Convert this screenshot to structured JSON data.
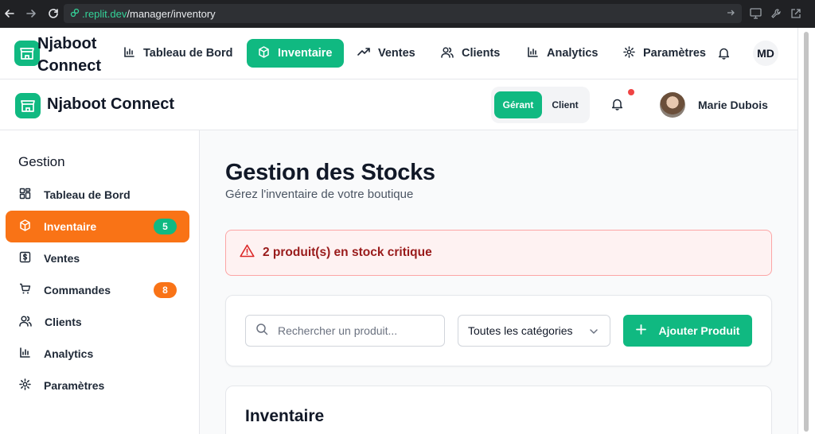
{
  "browser": {
    "url_host": ".replit.dev",
    "url_path": "/manager/inventory"
  },
  "topnav": {
    "brand": "Njaboot Connect",
    "items": [
      {
        "label": "Tableau de Bord",
        "icon": "bar-chart-icon"
      },
      {
        "label": "Inventaire",
        "icon": "package-icon",
        "active": true
      },
      {
        "label": "Ventes",
        "icon": "trending-up-icon"
      },
      {
        "label": "Clients",
        "icon": "users-icon"
      },
      {
        "label": "Analytics",
        "icon": "bar-chart-icon"
      },
      {
        "label": "Paramètres",
        "icon": "gear-icon"
      }
    ],
    "avatar_initials": "MD"
  },
  "header": {
    "brand": "Njaboot Connect",
    "toggle": {
      "option_active": "Gérant",
      "option_inactive": "Client"
    },
    "user_name": "Marie Dubois"
  },
  "sidebar": {
    "title": "Gestion",
    "items": [
      {
        "label": "Tableau de Bord",
        "icon": "dashboard-grid-icon"
      },
      {
        "label": "Inventaire",
        "icon": "package-icon",
        "badge": "5",
        "active": true
      },
      {
        "label": "Ventes",
        "icon": "dollar-icon"
      },
      {
        "label": "Commandes",
        "icon": "cart-icon",
        "badge": "8"
      },
      {
        "label": "Clients",
        "icon": "users-icon"
      },
      {
        "label": "Analytics",
        "icon": "bar-chart-icon"
      },
      {
        "label": "Paramètres",
        "icon": "gear-icon"
      }
    ]
  },
  "main": {
    "title": "Gestion des Stocks",
    "subtitle": "Gérez l'inventaire de votre boutique",
    "alert": "2 produit(s) en stock critique",
    "search_placeholder": "Rechercher un produit...",
    "category_select": "Toutes les catégories",
    "add_button": "Ajouter Produit",
    "inventory_title": "Inventaire"
  },
  "colors": {
    "accent_green": "#10b981",
    "accent_orange": "#f97316",
    "alert_red": "#991b1b"
  }
}
